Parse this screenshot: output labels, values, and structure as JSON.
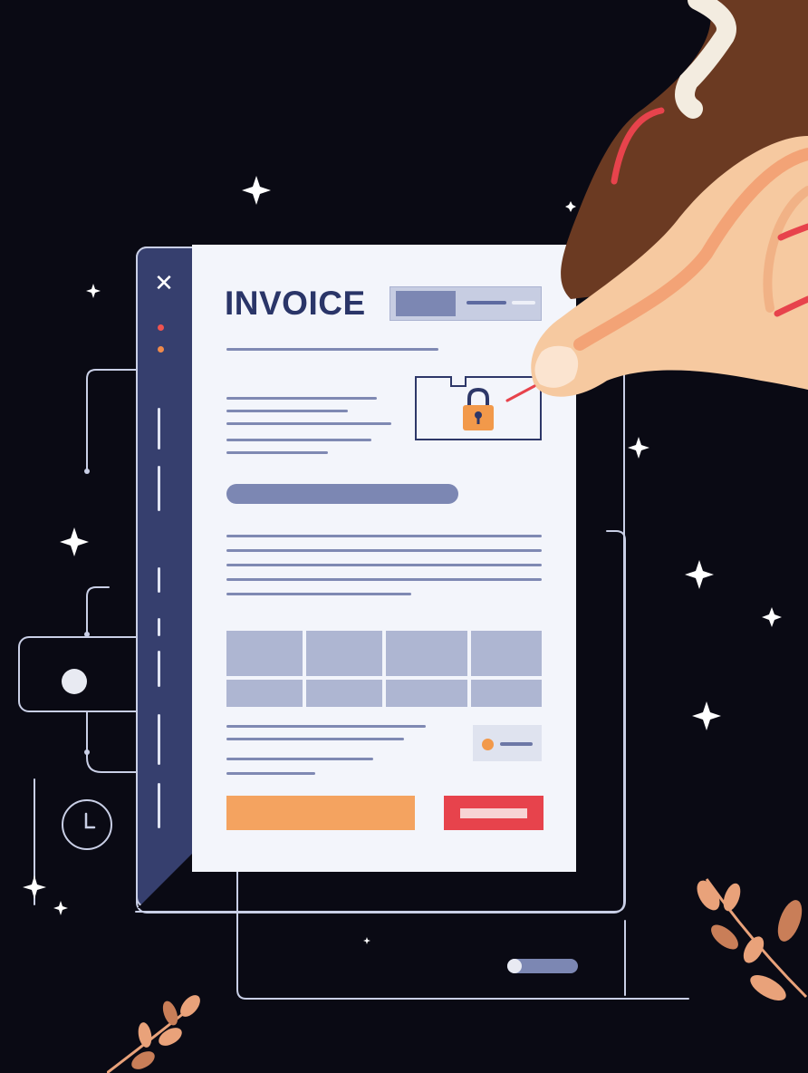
{
  "invoice": {
    "title": "INVOICE"
  },
  "sidebar": {
    "close_icon": "close-icon"
  },
  "icons": {
    "lock": "padlock-icon",
    "clock": "clock-icon",
    "sparkle": "sparkle-icon",
    "hand": "pointing-hand-illustration",
    "leaf": "leaf-branch-illustration"
  },
  "colors": {
    "background": "#0a0a14",
    "sidebar": "#363f6e",
    "paper": "#f3f5fb",
    "title": "#2a3568",
    "orange_button": "#f4a360",
    "red_button": "#e7434c",
    "lock": "#f2994a"
  }
}
